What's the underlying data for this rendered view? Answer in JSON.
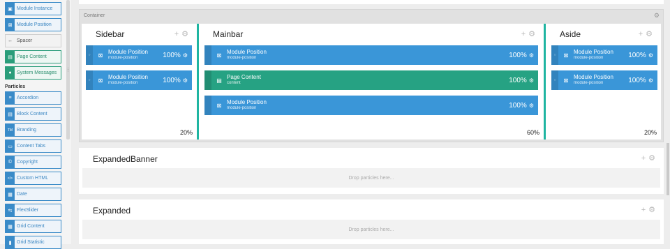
{
  "sidebar": {
    "top_items": [
      {
        "label": "Module Instance",
        "icon": "▣",
        "style": "blue"
      },
      {
        "label": "Module Position",
        "icon": "⊠",
        "style": "blue"
      },
      {
        "label": "Spacer",
        "icon": "↔",
        "style": "grey"
      },
      {
        "label": "Page Content",
        "icon": "▤",
        "style": "green"
      },
      {
        "label": "System Messages",
        "icon": "●",
        "style": "green"
      }
    ],
    "section_label": "Particles",
    "particles": [
      {
        "label": "Accordion",
        "icon": "≡"
      },
      {
        "label": "Block Content",
        "icon": "▤"
      },
      {
        "label": "Branding",
        "icon": "TM"
      },
      {
        "label": "Content Tabs",
        "icon": "▭"
      },
      {
        "label": "Copyright",
        "icon": "©"
      },
      {
        "label": "Custom HTML",
        "icon": "</>"
      },
      {
        "label": "Date",
        "icon": "▦"
      },
      {
        "label": "FlexSlider",
        "icon": "⇆"
      },
      {
        "label": "Grid Content",
        "icon": "▦"
      },
      {
        "label": "Grid Statistic",
        "icon": "▮"
      }
    ]
  },
  "container": {
    "title": "Container",
    "blocks": [
      {
        "title": "Sidebar",
        "percent": "20%",
        "modules": [
          {
            "title": "Module Position",
            "sub": "module-position",
            "percent": "100%",
            "color": "blue"
          },
          {
            "title": "Module Position",
            "sub": "module-position",
            "percent": "100%",
            "color": "blue"
          }
        ]
      },
      {
        "title": "Mainbar",
        "percent": "60%",
        "modules": [
          {
            "title": "Module Position",
            "sub": "module-position",
            "percent": "100%",
            "color": "blue"
          },
          {
            "title": "Page Content",
            "sub": "content",
            "percent": "100%",
            "color": "green"
          },
          {
            "title": "Module Position",
            "sub": "module-position",
            "percent": "100%",
            "color": "blue"
          }
        ]
      },
      {
        "title": "Aside",
        "percent": "20%",
        "modules": [
          {
            "title": "Module Position",
            "sub": "module-position",
            "percent": "100%",
            "color": "blue"
          },
          {
            "title": "Module Position",
            "sub": "module-position",
            "percent": "100%",
            "color": "blue"
          }
        ]
      }
    ]
  },
  "sections": [
    {
      "title": "ExpandedBanner",
      "drop_text": "Drop particles here..."
    },
    {
      "title": "Expanded",
      "drop_text": "Drop particles here..."
    }
  ],
  "colors": {
    "blue": "#3a96d8",
    "green": "#26a283",
    "divider": "#1fb5a1"
  }
}
